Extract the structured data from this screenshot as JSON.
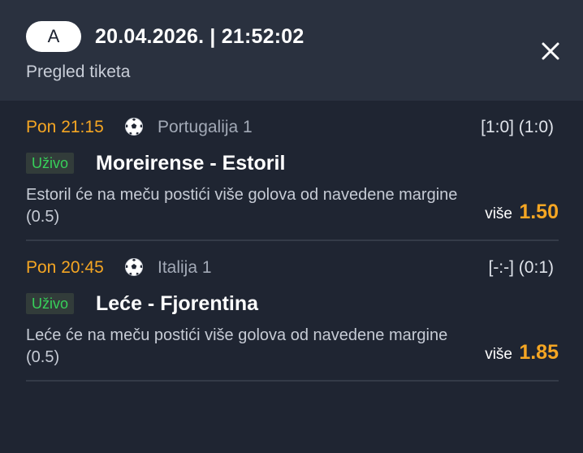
{
  "header": {
    "badge": "A",
    "datetime": "20.04.2026. | 21:52:02",
    "subtitle": "Pregled tiketa",
    "close_icon": "close-icon"
  },
  "bets": [
    {
      "time": "Pon 21:15",
      "sport_icon": "soccer-ball-icon",
      "league": "Portugalija 1",
      "score": "[1:0] (1:0)",
      "live_label": "Uživo",
      "match": "Moreirense - Estoril",
      "description": "Estoril će na meču postići više golova od navedene margine (0.5)",
      "odd_label": "više",
      "odd": "1.50"
    },
    {
      "time": "Pon 20:45",
      "sport_icon": "soccer-ball-icon",
      "league": "Italija 1",
      "score": "[-:-] (0:1)",
      "live_label": "Uživo",
      "match": "Leće - Fjorentina",
      "description": "Leće će na meču postići više golova od navedene margine (0.5)",
      "odd_label": "više",
      "odd": "1.85"
    }
  ],
  "colors": {
    "background": "#1f2532",
    "header_background": "#2a313f",
    "accent_orange": "#f5a623",
    "live_green": "#37d05a"
  }
}
